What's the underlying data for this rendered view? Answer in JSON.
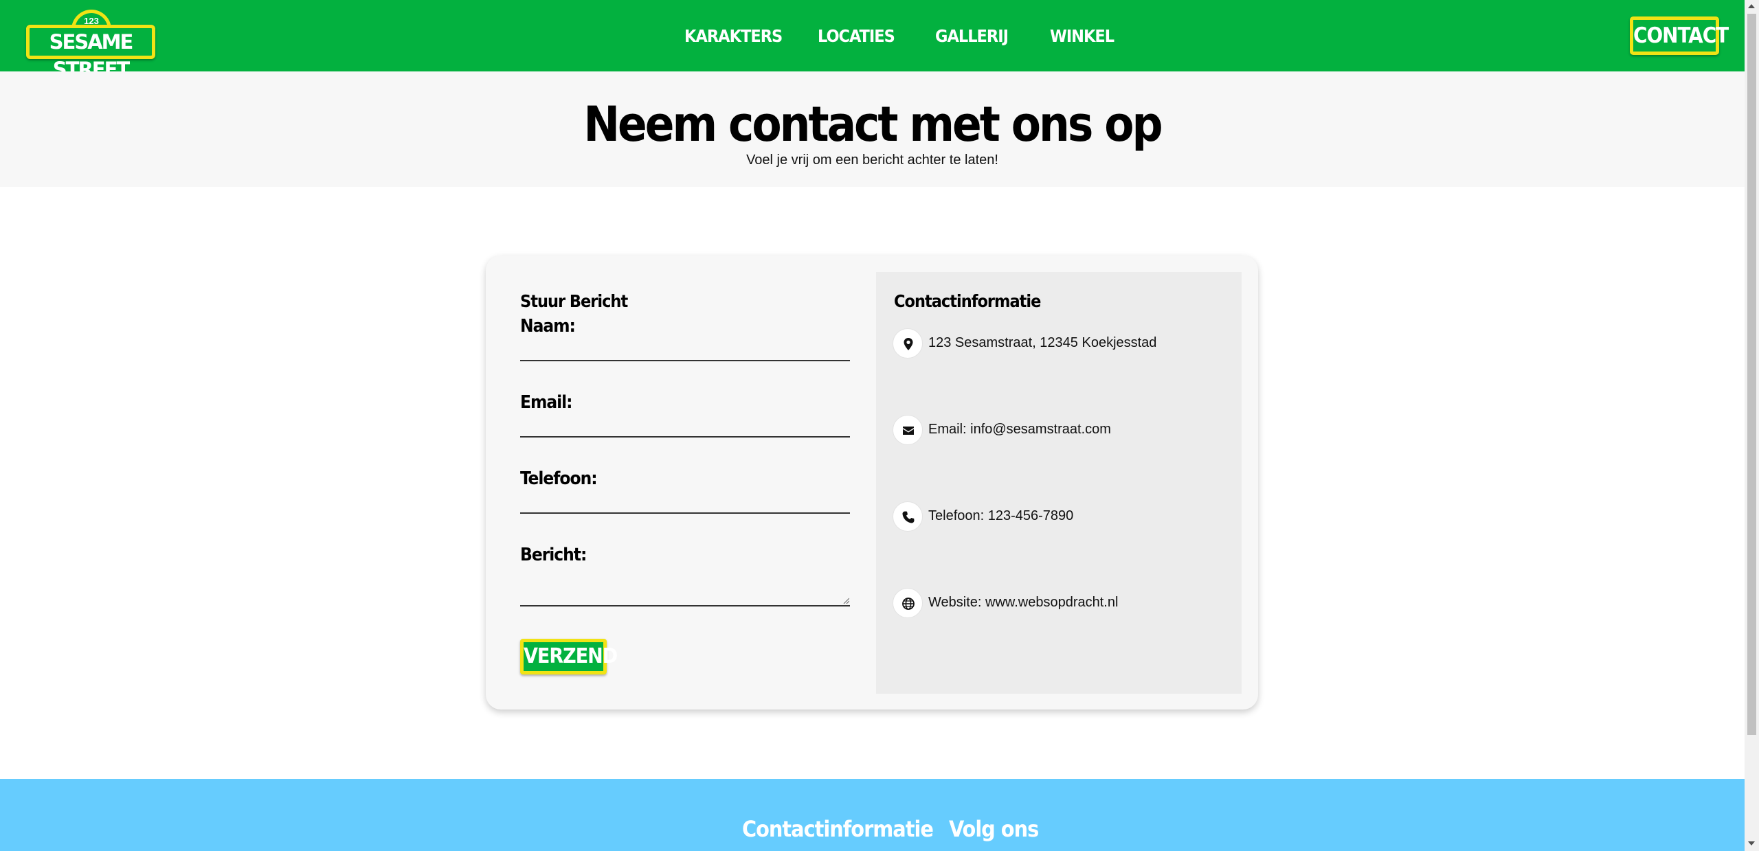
{
  "header": {
    "logo": {
      "number": "123",
      "text": "SESAME STREET"
    },
    "nav": [
      {
        "label": "KARAKTERS"
      },
      {
        "label": "LOCATIES"
      },
      {
        "label": "GALLERIJ"
      },
      {
        "label": "WINKEL"
      }
    ],
    "contact_button": "CONTACT"
  },
  "hero": {
    "title": "Neem contact met ons op",
    "subtitle": "Voel je vrij om een bericht achter te laten!"
  },
  "form": {
    "title": "Stuur Bericht",
    "fields": [
      {
        "label": "Naam:",
        "value": ""
      },
      {
        "label": "Email:",
        "value": ""
      },
      {
        "label": "Telefoon:",
        "value": ""
      },
      {
        "label": "Bericht:",
        "value": ""
      }
    ],
    "submit": "VERZEND"
  },
  "info": {
    "title": "Contactinformatie",
    "items": [
      {
        "icon": "location-pin-icon",
        "text": "123 Sesamstraat, 12345 Koekjesstad"
      },
      {
        "icon": "envelope-icon",
        "text": "Email: info@sesamstraat.com"
      },
      {
        "icon": "phone-icon",
        "text": "Telefoon: 123-456-7890"
      },
      {
        "icon": "globe-icon",
        "text": "Website: www.websopdracht.nl"
      }
    ]
  },
  "footer": {
    "headings": [
      "Contactinformatie",
      "Volg ons"
    ]
  },
  "colors": {
    "brand_green": "#03b13f",
    "brand_yellow": "#f1e315",
    "footer_blue": "#66ccfe"
  }
}
